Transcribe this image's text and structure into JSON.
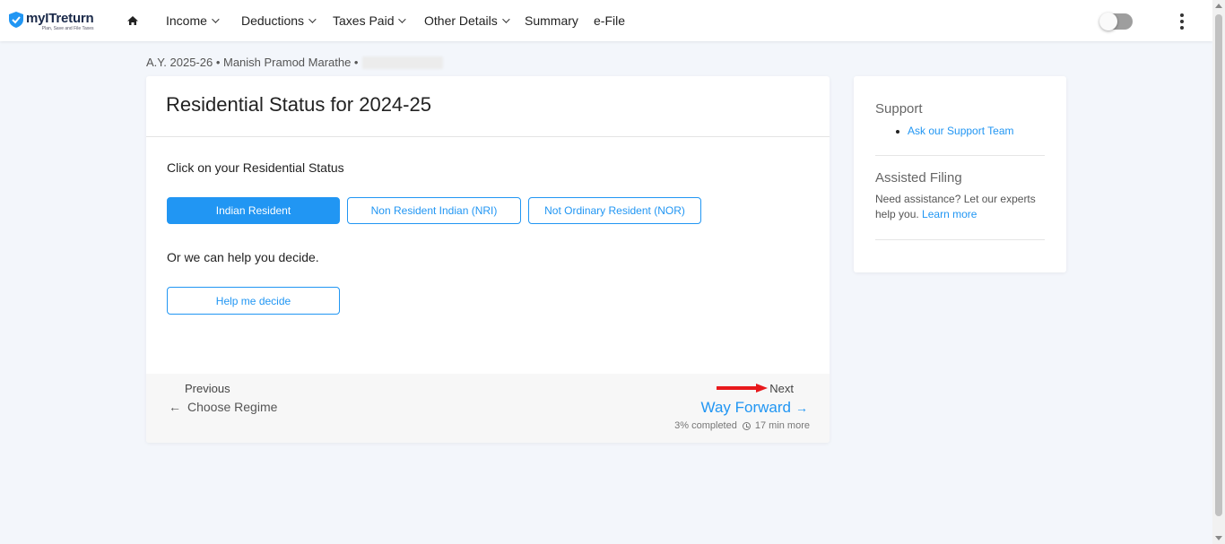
{
  "brand": {
    "name": "myITreturn",
    "tagline": "Plan, Save and File Taxes",
    "color": "#2196f3"
  },
  "nav": {
    "items": [
      {
        "label": "Income",
        "dropdown": true
      },
      {
        "label": "Deductions",
        "dropdown": true
      },
      {
        "label": "Taxes Paid",
        "dropdown": true
      },
      {
        "label": "Other Details",
        "dropdown": true
      },
      {
        "label": "Summary",
        "dropdown": false
      },
      {
        "label": "e-File",
        "dropdown": false
      }
    ],
    "toggle_state": "off"
  },
  "breadcrumb": {
    "text": "A.Y. 2025-26 • Manish Pramod Marathe •"
  },
  "main": {
    "title": "Residential Status for 2024-25",
    "prompt": "Click on your Residential Status",
    "options": [
      {
        "label": "Indian Resident",
        "selected": true
      },
      {
        "label": "Non Resident Indian (NRI)",
        "selected": false
      },
      {
        "label": "Not Ordinary Resident (NOR)",
        "selected": false
      }
    ],
    "or_text": "Or we can help you decide.",
    "help_button": "Help me decide"
  },
  "footer": {
    "previous_label": "Previous",
    "previous_link": "Choose Regime",
    "next_label": "Next",
    "next_link": "Way Forward",
    "progress_text": "3% completed",
    "progress_percent": 3,
    "time_text": "17 min more"
  },
  "side": {
    "support_heading": "Support",
    "support_link": "Ask our Support Team",
    "assisted_heading": "Assisted Filing",
    "assisted_text": "Need assistance? Let our experts help you.",
    "assisted_link": "Learn more"
  },
  "annotation_color": "#e8191c"
}
